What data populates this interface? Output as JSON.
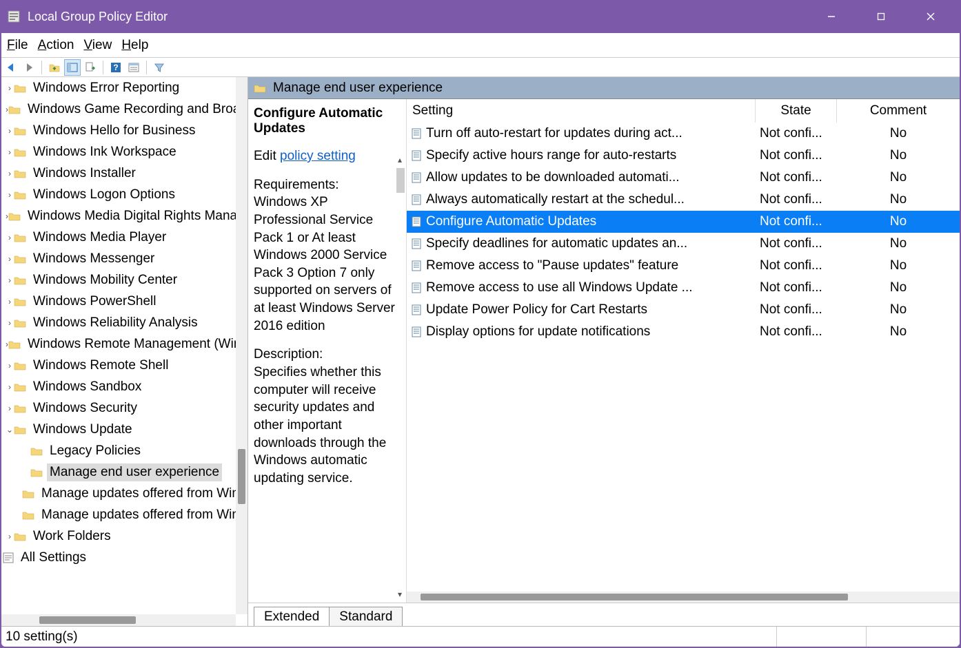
{
  "window": {
    "title": "Local Group Policy Editor"
  },
  "menu": {
    "file": "File",
    "action": "Action",
    "view": "View",
    "help": "Help"
  },
  "tree": {
    "items": [
      {
        "label": "Windows Error Reporting",
        "level": 0
      },
      {
        "label": "Windows Game Recording and Broadcasting",
        "level": 0
      },
      {
        "label": "Windows Hello for Business",
        "level": 0
      },
      {
        "label": "Windows Ink Workspace",
        "level": 0
      },
      {
        "label": "Windows Installer",
        "level": 0
      },
      {
        "label": "Windows Logon Options",
        "level": 0
      },
      {
        "label": "Windows Media Digital Rights Management",
        "level": 0
      },
      {
        "label": "Windows Media Player",
        "level": 0
      },
      {
        "label": "Windows Messenger",
        "level": 0
      },
      {
        "label": "Windows Mobility Center",
        "level": 0
      },
      {
        "label": "Windows PowerShell",
        "level": 0
      },
      {
        "label": "Windows Reliability Analysis",
        "level": 0
      },
      {
        "label": "Windows Remote Management (WinRM)",
        "level": 0
      },
      {
        "label": "Windows Remote Shell",
        "level": 0
      },
      {
        "label": "Windows Sandbox",
        "level": 0
      },
      {
        "label": "Windows Security",
        "level": 0
      },
      {
        "label": "Windows Update",
        "level": 0,
        "expanded": true
      },
      {
        "label": "Legacy Policies",
        "level": 1
      },
      {
        "label": "Manage end user experience",
        "level": 1,
        "selected": true
      },
      {
        "label": "Manage updates offered from Windows Update",
        "level": 1
      },
      {
        "label": "Manage updates offered from Windows Server Update Service",
        "level": 1
      },
      {
        "label": "Work Folders",
        "level": 0
      },
      {
        "label": "All Settings",
        "level": -1
      }
    ]
  },
  "right": {
    "header": "Manage end user experience",
    "desc": {
      "title": "Configure Automatic Updates",
      "edit_prefix": "Edit ",
      "edit_link": "policy setting ",
      "requirements_label": "Requirements:",
      "requirements_text": "Windows XP Professional Service Pack 1 or At least Windows 2000 Service Pack 3 Option 7 only supported on servers of at least Windows Server 2016 edition",
      "description_label": "Description:",
      "description_text": "Specifies whether this computer will receive security updates and other important downloads through the Windows automatic updating service."
    },
    "columns": {
      "setting": "Setting",
      "state": "State",
      "comment": "Comment"
    },
    "rows": [
      {
        "setting": "Turn off auto-restart for updates during act...",
        "state": "Not confi...",
        "comment": "No"
      },
      {
        "setting": "Specify active hours range for auto-restarts",
        "state": "Not confi...",
        "comment": "No"
      },
      {
        "setting": "Allow updates to be downloaded automati...",
        "state": "Not confi...",
        "comment": "No"
      },
      {
        "setting": "Always automatically restart at the schedul...",
        "state": "Not confi...",
        "comment": "No"
      },
      {
        "setting": "Configure Automatic Updates",
        "state": "Not confi...",
        "comment": "No",
        "selected": true
      },
      {
        "setting": "Specify deadlines for automatic updates an...",
        "state": "Not confi...",
        "comment": "No"
      },
      {
        "setting": "Remove access to \"Pause updates\" feature",
        "state": "Not confi...",
        "comment": "No"
      },
      {
        "setting": "Remove access to use all Windows Update ...",
        "state": "Not confi...",
        "comment": "No"
      },
      {
        "setting": "Update Power Policy for Cart Restarts",
        "state": "Not confi...",
        "comment": "No"
      },
      {
        "setting": "Display options for update notifications",
        "state": "Not confi...",
        "comment": "No"
      }
    ]
  },
  "tabs": {
    "extended": "Extended",
    "standard": "Standard"
  },
  "status": {
    "text": "10 setting(s)"
  }
}
